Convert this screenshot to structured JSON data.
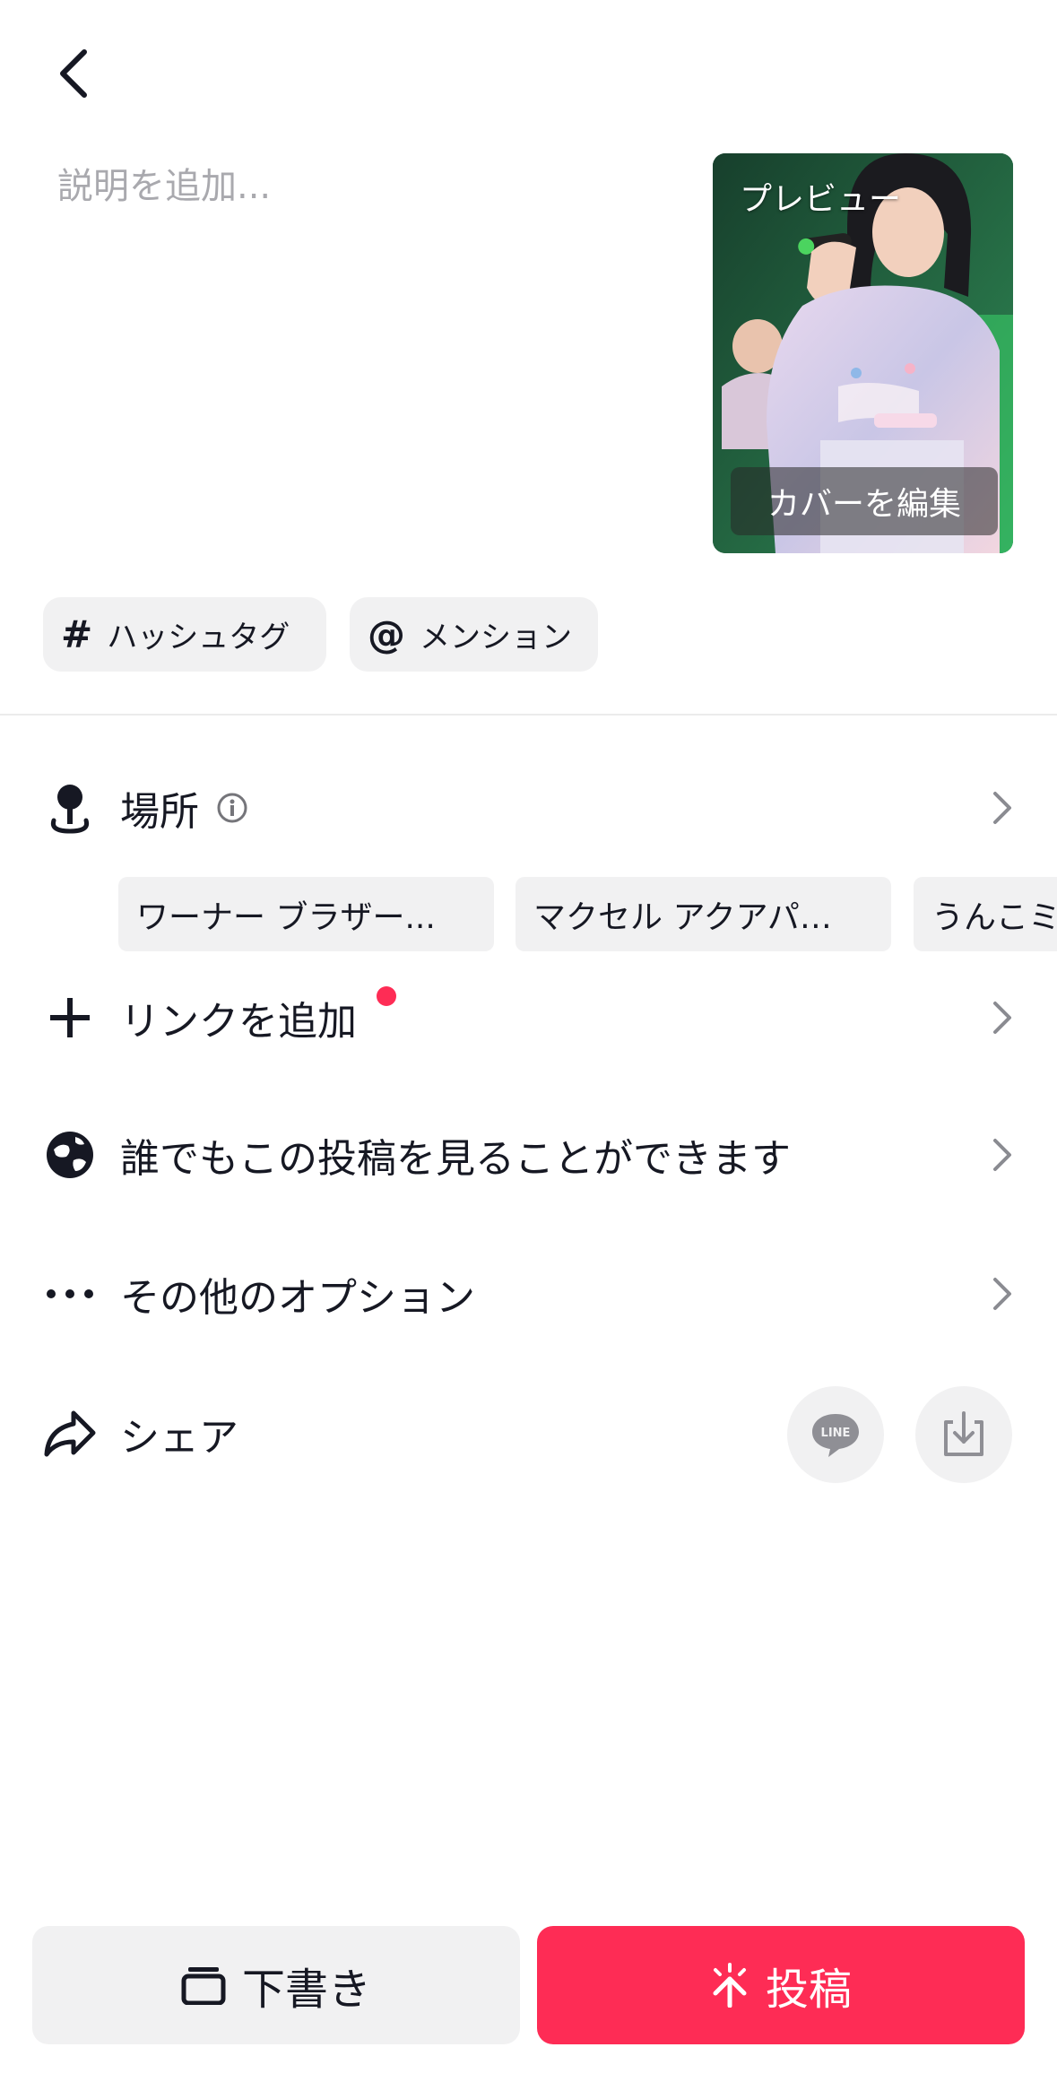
{
  "header": {
    "back_icon": "chevron-left-icon"
  },
  "description": {
    "placeholder": "説明を追加...",
    "value": ""
  },
  "cover": {
    "preview_label": "プレビュー",
    "edit_label": "カバーを編集"
  },
  "tags": [
    {
      "symbol": "#",
      "label": "ハッシュタグ"
    },
    {
      "symbol": "@",
      "label": "メンション"
    }
  ],
  "location": {
    "label": "場所",
    "info_icon": "info-icon",
    "suggestions": [
      "ワーナー ブラザー...",
      "マクセル アクアパ…",
      "うんこミ"
    ]
  },
  "link": {
    "label": "リンクを追加",
    "icon": "plus-icon",
    "has_badge": true
  },
  "privacy": {
    "label": "誰でもこの投稿を見ることができます",
    "icon": "globe-icon"
  },
  "more_options": {
    "label": "その他のオプション",
    "icon": "more-horizontal-icon"
  },
  "share": {
    "label": "シェア",
    "icon": "share-arrow-icon",
    "line_label": "LINE",
    "download_icon": "download-icon"
  },
  "actions": {
    "draft_label": "下書き",
    "post_label": "投稿"
  },
  "colors": {
    "primary": "#fe2c55",
    "chip_bg": "#f1f1f2",
    "text": "#161823"
  }
}
